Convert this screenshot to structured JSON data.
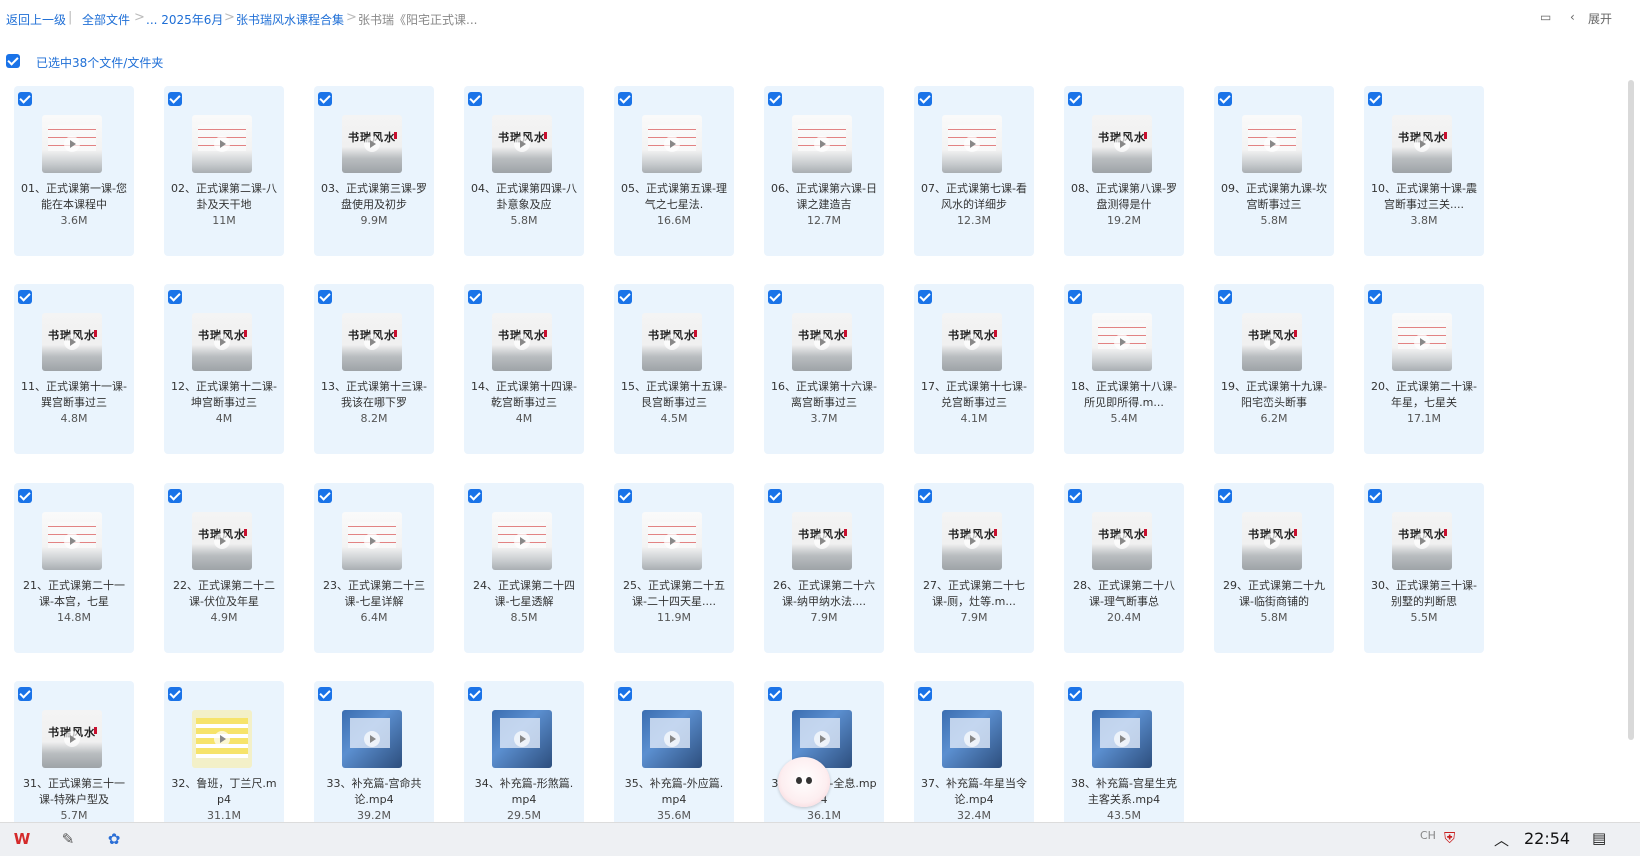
{
  "breadcrumb": {
    "back": "返回上一级",
    "all_files": "全部文件",
    "ellipsis_month": "... 2025年6月",
    "folder": "张书瑞风水课程合集",
    "current": "张书瑞《阳宅正式课..."
  },
  "toolbar": {
    "expand": "展开"
  },
  "selection": {
    "label": "已选中38个文件/文件夹"
  },
  "files": [
    {
      "name": "01、正式课第一课-您能在本课程中",
      "size": "3.6M",
      "thumb": "slides"
    },
    {
      "name": "02、正式课第二课-八卦及天干地",
      "size": "11M",
      "thumb": "slides"
    },
    {
      "name": "03、正式课第三课-罗盘使用及初步",
      "size": "9.9M",
      "thumb": "brand"
    },
    {
      "name": "04、正式课第四课-八卦意象及应",
      "size": "5.8M",
      "thumb": "brand"
    },
    {
      "name": "05、正式课第五课-理气之七星法.",
      "size": "16.6M",
      "thumb": "slides"
    },
    {
      "name": "06、正式课第六课-日课之建造吉",
      "size": "12.7M",
      "thumb": "slides"
    },
    {
      "name": "07、正式课第七课-看风水的详细步",
      "size": "12.3M",
      "thumb": "slides"
    },
    {
      "name": "08、正式课第八课-罗盘测得是什",
      "size": "19.2M",
      "thumb": "brand"
    },
    {
      "name": "09、正式课第九课-坎宫断事过三",
      "size": "5.8M",
      "thumb": "slides"
    },
    {
      "name": "10、正式课第十课-震宫断事过三关....",
      "size": "3.8M",
      "thumb": "brand"
    },
    {
      "name": "11、正式课第十一课-巽宫断事过三",
      "size": "4.8M",
      "thumb": "brand"
    },
    {
      "name": "12、正式课第十二课-坤宫断事过三",
      "size": "4M",
      "thumb": "brand"
    },
    {
      "name": "13、正式课第十三课-我该在哪下罗",
      "size": "8.2M",
      "thumb": "brand"
    },
    {
      "name": "14、正式课第十四课-乾宫断事过三",
      "size": "4M",
      "thumb": "brand"
    },
    {
      "name": "15、正式课第十五课-艮宫断事过三",
      "size": "4.5M",
      "thumb": "brand"
    },
    {
      "name": "16、正式课第十六课-离宫断事过三",
      "size": "3.7M",
      "thumb": "brand"
    },
    {
      "name": "17、正式课第十七课-兑宫断事过三",
      "size": "4.1M",
      "thumb": "brand"
    },
    {
      "name": "18、正式课第十八课-所见即所得.m...",
      "size": "5.4M",
      "thumb": "slides"
    },
    {
      "name": "19、正式课第十九课-阳宅峦头断事",
      "size": "6.2M",
      "thumb": "brand"
    },
    {
      "name": "20、正式课第二十课-年星，七星关",
      "size": "17.1M",
      "thumb": "slides"
    },
    {
      "name": "21、正式课第二十一课-本宫，七星",
      "size": "14.8M",
      "thumb": "slides"
    },
    {
      "name": "22、正式课第二十二课-伏位及年星",
      "size": "4.9M",
      "thumb": "brand"
    },
    {
      "name": "23、正式课第二十三课-七星详解",
      "size": "6.4M",
      "thumb": "slides"
    },
    {
      "name": "24、正式课第二十四课-七星透解",
      "size": "8.5M",
      "thumb": "slides"
    },
    {
      "name": "25、正式课第二十五课-二十四天星....",
      "size": "11.9M",
      "thumb": "slides"
    },
    {
      "name": "26、正式课第二十六课-纳甲纳水法....",
      "size": "7.9M",
      "thumb": "brand"
    },
    {
      "name": "27、正式课第二十七课-厕，灶等.m...",
      "size": "7.9M",
      "thumb": "brand"
    },
    {
      "name": "28、正式课第二十八课-理气断事总",
      "size": "20.4M",
      "thumb": "brand"
    },
    {
      "name": "29、正式课第二十九课-临街商铺的",
      "size": "5.8M",
      "thumb": "brand"
    },
    {
      "name": "30、正式课第三十课-别墅的判断思",
      "size": "5.5M",
      "thumb": "brand"
    },
    {
      "name": "31、正式课第三十一课-特殊户型及",
      "size": "5.7M",
      "thumb": "brand"
    },
    {
      "name": "32、鲁班，丁兰尺.mp4",
      "size": "31.1M",
      "thumb": "yellow"
    },
    {
      "name": "33、补充篇-宫命共论.mp4",
      "size": "39.2M",
      "thumb": "photo"
    },
    {
      "name": "34、补充篇-形煞篇.mp4",
      "size": "29.5M",
      "thumb": "photo"
    },
    {
      "name": "35、补充篇-外应篇.mp4",
      "size": "35.6M",
      "thumb": "photo"
    },
    {
      "name": "36、补充篇-全息.mp4",
      "size": "36.1M",
      "thumb": "photo"
    },
    {
      "name": "37、补充篇-年星当令论.mp4",
      "size": "32.4M",
      "thumb": "photo"
    },
    {
      "name": "38、补充篇-宫星生克主客关系.mp4",
      "size": "43.5M",
      "thumb": "photo"
    }
  ],
  "thumb_brand_text": "书瑞风水",
  "taskbar": {
    "clock": "22:54",
    "icons": [
      "wps-icon",
      "notepad-icon",
      "app-icon"
    ],
    "tray_text": "CH"
  },
  "colors": {
    "accent": "#1a73e8",
    "tile_bg": "#eaf4fd",
    "link": "#1f6fd6"
  }
}
